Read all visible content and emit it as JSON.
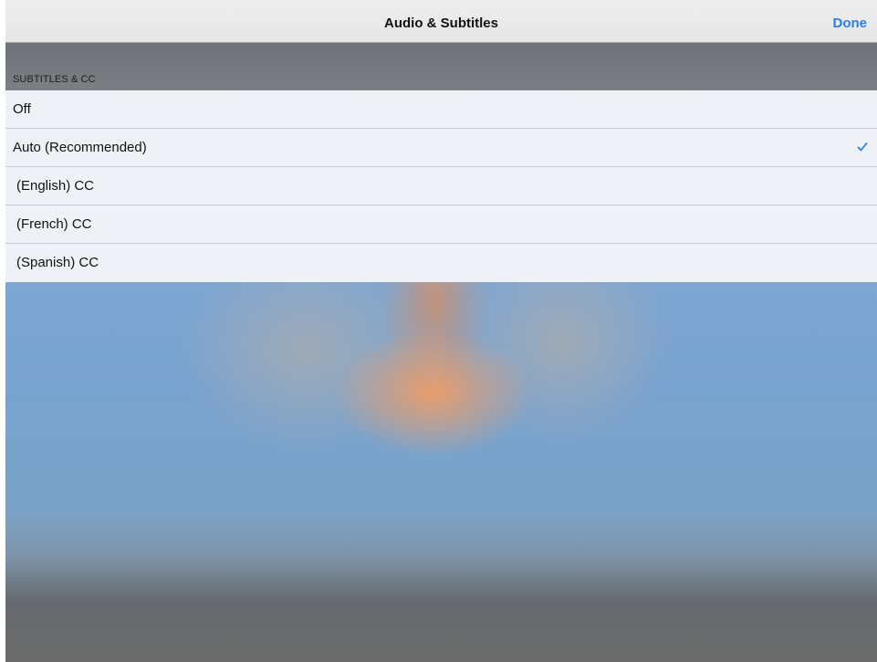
{
  "header": {
    "title": "Audio & Subtitles",
    "done_label": "Done"
  },
  "section": {
    "title": "SUBTITLES & CC"
  },
  "options": [
    {
      "label": "Off",
      "selected": false
    },
    {
      "label": "Auto (Recommended)",
      "selected": true
    },
    {
      "label": "(English) CC",
      "selected": false
    },
    {
      "label": "(French) CC",
      "selected": false
    },
    {
      "label": "(Spanish) CC",
      "selected": false
    }
  ],
  "icons": {
    "selected_indicator": "checkmark-icon"
  },
  "colors": {
    "accent": "#2a7ee6",
    "navbar": "#eeeeee",
    "list_background": "#eef2f6"
  }
}
